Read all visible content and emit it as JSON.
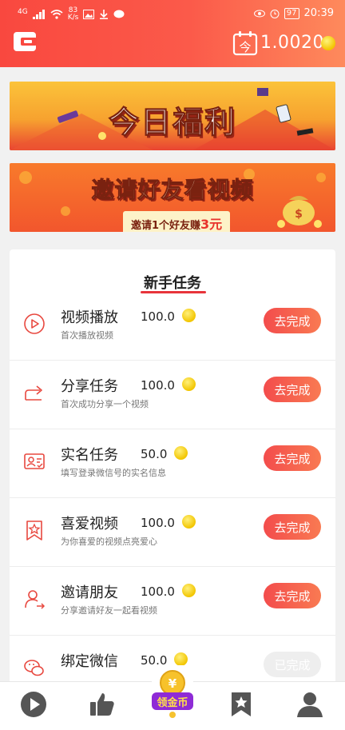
{
  "status_bar": {
    "network": "4G",
    "speed_value": "83",
    "speed_unit": "K/s",
    "battery": "97",
    "time": "20:39"
  },
  "header": {
    "checkin_label": "今",
    "coin_balance": "1.0020"
  },
  "banners": [
    {
      "title": "今日福利"
    },
    {
      "title": "邀请好友看视频",
      "subtitle_prefix": "邀请1个好友赚",
      "subtitle_amount": "3元"
    }
  ],
  "task_section": {
    "title": "新手任务",
    "tasks": [
      {
        "icon": "play-circle-icon",
        "name": "视频播放",
        "reward": "100.0",
        "desc": "首次播放视频",
        "button": "去完成",
        "done": false
      },
      {
        "icon": "share-icon",
        "name": "分享任务",
        "reward": "100.0",
        "desc": "首次成功分享一个视频",
        "button": "去完成",
        "done": false
      },
      {
        "icon": "id-card-icon",
        "name": "实名任务",
        "reward": "50.0",
        "desc": "填写登录微信号的实名信息",
        "button": "去完成",
        "done": false
      },
      {
        "icon": "bookmark-star-icon",
        "name": "喜爱视频",
        "reward": "100.0",
        "desc": "为你喜爱的视频点亮爱心",
        "button": "去完成",
        "done": false
      },
      {
        "icon": "add-user-icon",
        "name": "邀请朋友",
        "reward": "100.0",
        "desc": "分享邀请好友一起看视频",
        "button": "去完成",
        "done": false
      },
      {
        "icon": "wechat-icon",
        "name": "绑定微信",
        "reward": "50.0",
        "desc": "",
        "button": "已完成",
        "done": true
      }
    ]
  },
  "bottom_nav": {
    "items": [
      {
        "icon": "play-icon"
      },
      {
        "icon": "thumbs-up-icon"
      },
      {
        "icon": "collect-coin-icon",
        "label": "领金币"
      },
      {
        "icon": "bookmark-icon"
      },
      {
        "icon": "profile-icon"
      }
    ]
  },
  "colors": {
    "accent": "#f9483f",
    "button_gradient_start": "#f34c4c",
    "button_gradient_end": "#f97a52",
    "coin": "#f2c500"
  }
}
